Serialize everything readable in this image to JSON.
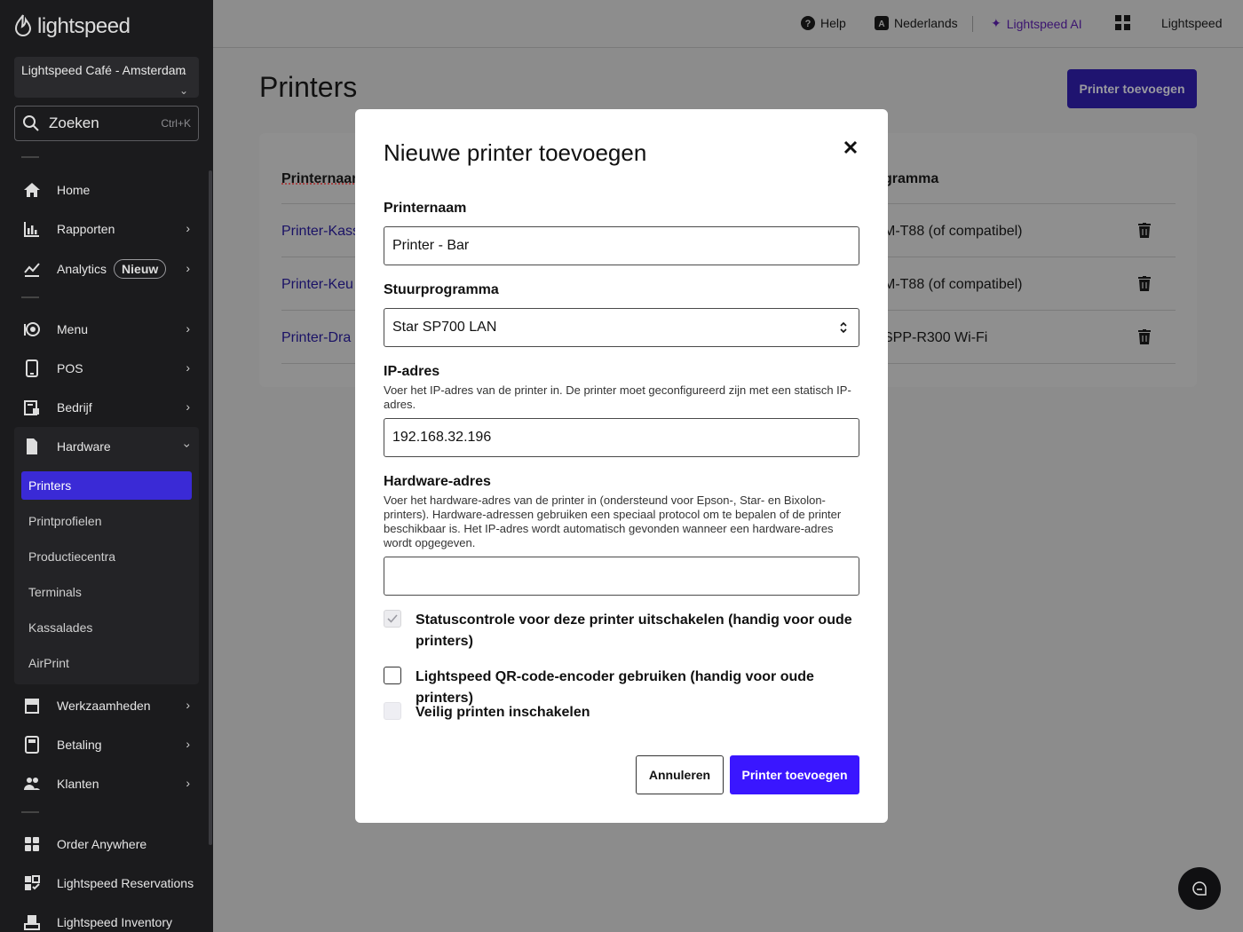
{
  "sidebar": {
    "logo_text": "lightspeed",
    "store_name": "Lightspeed Café - Amsterdam",
    "search_label": "Zoeken",
    "search_shortcut": "Ctrl+K",
    "items": {
      "home": "Home",
      "rapporten": "Rapporten",
      "analytics": "Analytics",
      "analytics_badge": "Nieuw",
      "menu": "Menu",
      "pos": "POS",
      "bedrijf": "Bedrijf",
      "hardware": "Hardware",
      "werkzaamheden": "Werkzaamheden",
      "betaling": "Betaling",
      "klanten": "Klanten",
      "order_anywhere": "Order Anywhere",
      "reservations": "Lightspeed Reservations",
      "inventory": "Lightspeed Inventory"
    },
    "hardware_sub": [
      "Printers",
      "Printprofielen",
      "Productiecentra",
      "Terminals",
      "Kassalades",
      "AirPrint"
    ]
  },
  "topbar": {
    "help": "Help",
    "language": "Nederlands",
    "ai": "Lightspeed AI",
    "account": "Lightspeed"
  },
  "page": {
    "title": "Printers",
    "add_button": "Printer toevoegen",
    "col_name": "Printernaam",
    "col_driver": "gramma",
    "rows": [
      {
        "name": "Printer-Kass",
        "driver": "M-T88 (of compatibel)"
      },
      {
        "name": "Printer-Keu",
        "driver": "M-T88 (of compatibel)"
      },
      {
        "name": "Printer-Dra",
        "driver": "SPP-R300 Wi-Fi"
      }
    ]
  },
  "modal": {
    "title": "Nieuwe printer toevoegen",
    "name_label": "Printernaam",
    "name_value": "Printer - Bar",
    "driver_label": "Stuurprogramma",
    "driver_value": "Star SP700 LAN",
    "ip_label": "IP-adres",
    "ip_help": "Voer het IP-adres van de printer in. De printer moet geconfigureerd zijn met een statisch IP-adres.",
    "ip_value": "192.168.32.196",
    "hw_label": "Hardware-adres",
    "hw_help": "Voer het hardware-adres van de printer in (ondersteund voor Epson-, Star- en Bixolon-printers). Hardware-adressen gebruiken een speciaal protocol om te bepalen of de printer beschikbaar is. Het IP-adres wordt automatisch gevonden wanneer een hardware-adres wordt opgegeven.",
    "hw_value": "",
    "checkbox_status": "Statuscontrole voor deze printer uitschakelen (handig voor oude printers)",
    "checkbox_qr": "Lightspeed QR-code-encoder gebruiken (handig voor oude printers)",
    "checkbox_secure": "Veilig printen inschakelen",
    "cancel": "Annuleren",
    "submit": "Printer toevoegen"
  },
  "colors": {
    "sidebar_bg": "#1b1b1d",
    "accent": "#3a16ff",
    "active_nav": "#3a2ad6",
    "ai_purple": "#3b1470"
  }
}
